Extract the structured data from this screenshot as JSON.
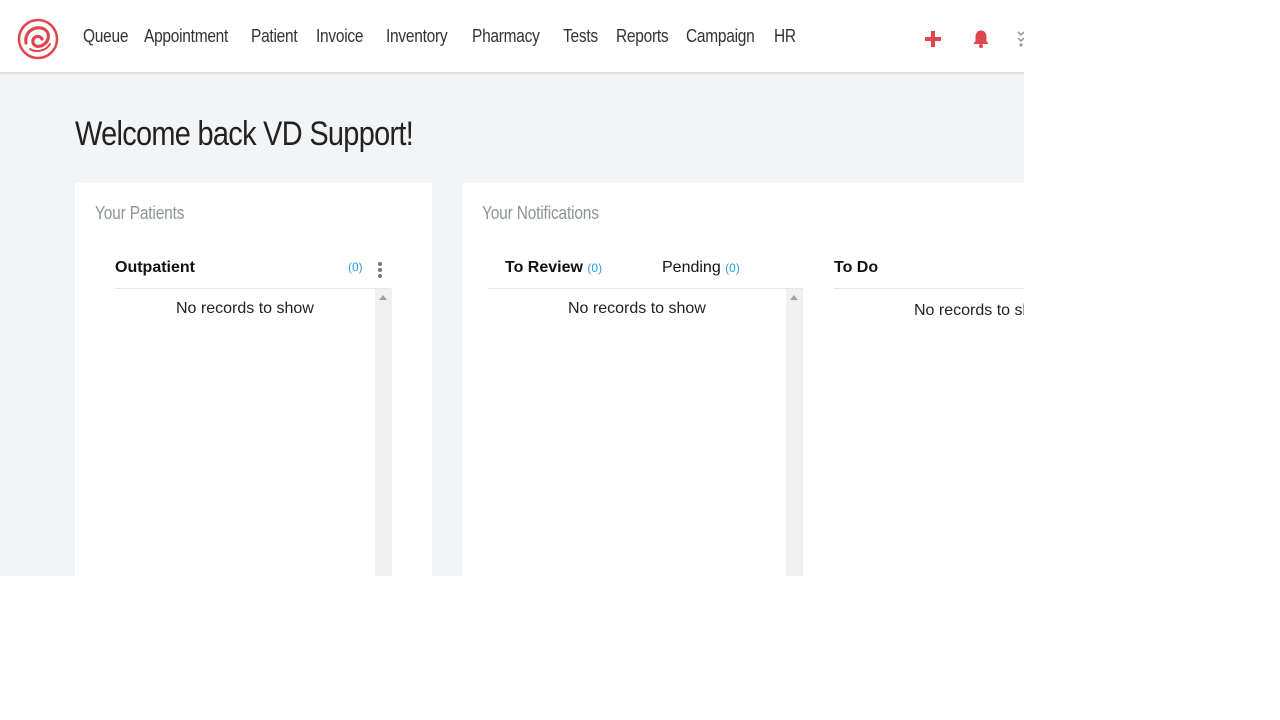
{
  "nav": {
    "items": [
      "Queue",
      "Appointment",
      "Patient",
      "Invoice",
      "Inventory",
      "Pharmacy",
      "Tests",
      "Reports",
      "Campaign",
      "HR"
    ]
  },
  "icons": {
    "logo": "clinic-logo-icon",
    "add": "plus-icon",
    "notifications": "bell-icon",
    "more": "more-icon"
  },
  "colors": {
    "brand_red": "#e0464e",
    "count_blue": "#2a9ee0",
    "muted_title": "#8e9499"
  },
  "welcome": {
    "text": "Welcome back VD Support!"
  },
  "patients": {
    "title": "Your Patients",
    "tab_label": "Outpatient",
    "count": "(0)",
    "empty": "No records to show"
  },
  "notifications": {
    "title": "Your Notifications",
    "to_review": {
      "label": "To Review",
      "count": "(0)"
    },
    "pending": {
      "label": "Pending",
      "count": "(0)"
    },
    "empty": "No records to show",
    "todo": {
      "label": "To Do",
      "empty": "No records to show"
    }
  }
}
